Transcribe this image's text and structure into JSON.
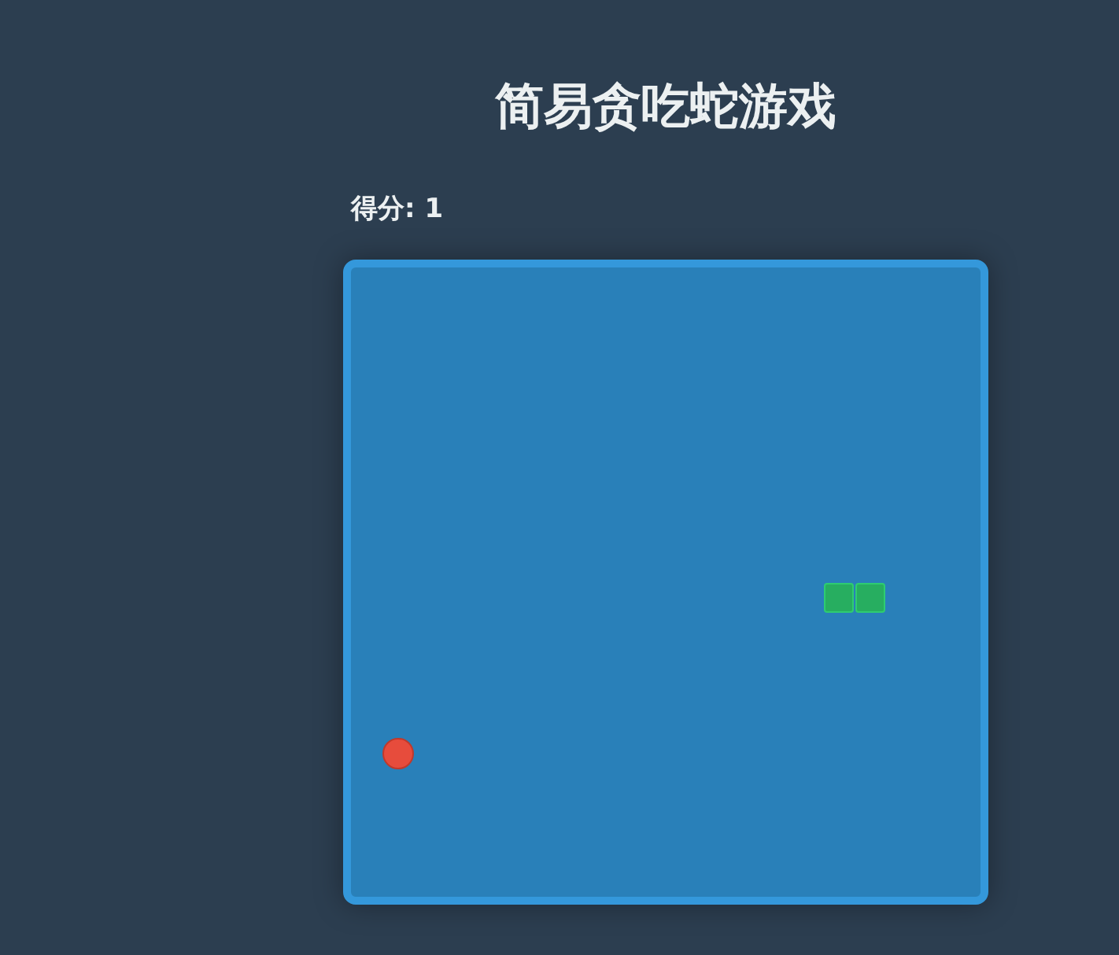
{
  "title": "简易贪吃蛇游戏",
  "score": "得分: 1"
}
